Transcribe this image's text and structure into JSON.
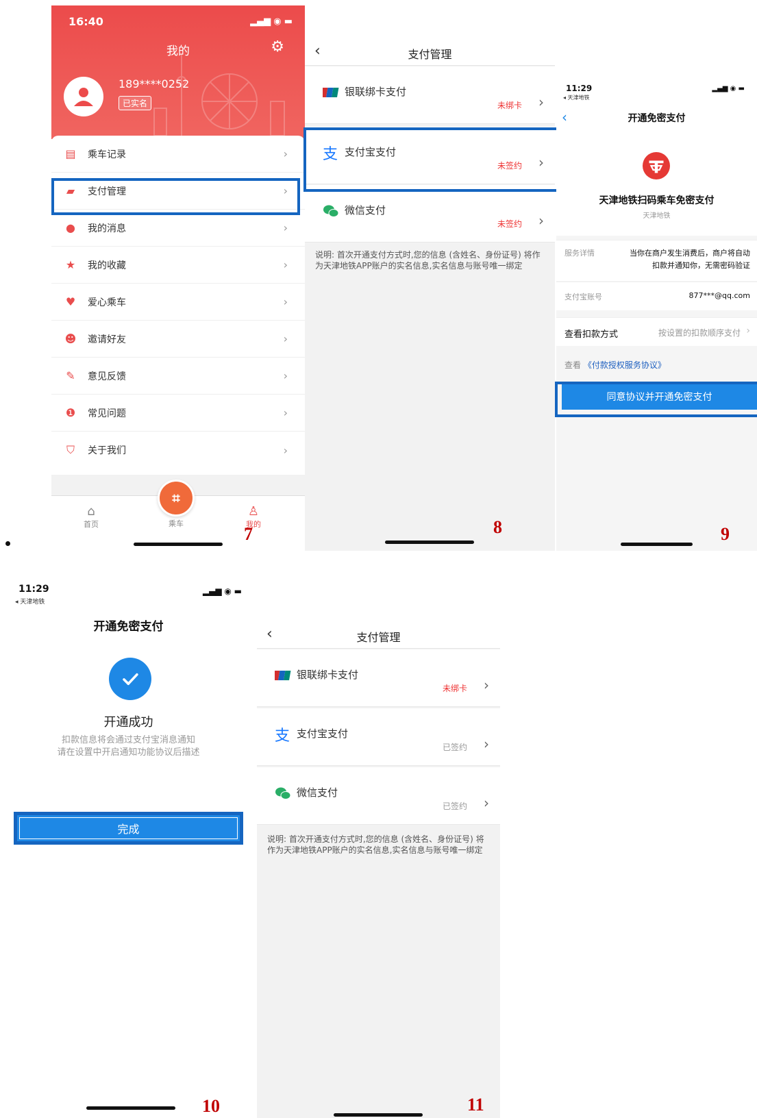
{
  "p7": {
    "time": "16:40",
    "title": "我的",
    "phone": "189****0252",
    "badge": "已实名",
    "menu": [
      {
        "label": "乘车记录",
        "icon": "ticket-icon"
      },
      {
        "label": "支付管理",
        "icon": "wallet-icon"
      },
      {
        "label": "我的消息",
        "icon": "message-icon"
      },
      {
        "label": "我的收藏",
        "icon": "star-icon"
      },
      {
        "label": "爱心乘车",
        "icon": "heart-icon"
      },
      {
        "label": "邀请好友",
        "icon": "friends-icon"
      },
      {
        "label": "意见反馈",
        "icon": "feedback-icon"
      },
      {
        "label": "常见问题",
        "icon": "info-icon"
      },
      {
        "label": "关于我们",
        "icon": "metro-logo-icon"
      }
    ],
    "tabs": {
      "home": "首页",
      "ride": "乘车",
      "mine": "我的"
    },
    "step": "7"
  },
  "p8": {
    "title": "支付管理",
    "rows": [
      {
        "label": "银联绑卡支付",
        "status": "未绑卡"
      },
      {
        "label": "支付宝支付",
        "status": "未签约"
      },
      {
        "label": "微信支付",
        "status": "未签约"
      }
    ],
    "note": "说明: 首次开通支付方式时,您的信息 (含姓名、身份证号) 将作为天津地铁APP账户的实名信息,实名信息与账号唯一绑定",
    "step": "8"
  },
  "p9": {
    "time": "11:29",
    "back_app": "◂ 天津地铁",
    "title": "开通免密支付",
    "service_name": "天津地铁扫码乘车免密支付",
    "service_sub": "天津地铁",
    "detail_key": "服务详情",
    "detail_value_1": "当你在商户发生消费后，商户将自动",
    "detail_value_2": "扣款并通知你，无需密码验证",
    "account_key": "支付宝账号",
    "account_value": "877***@qq.com",
    "method_key": "查看扣款方式",
    "method_value": "按设置的扣款顺序支付",
    "link_prefix": "查看",
    "link_text": "《付款授权服务协议》",
    "button": "同意协议并开通免密支付",
    "step": "9"
  },
  "p10": {
    "time": "11:29",
    "back_app": "◂ 天津地铁",
    "title": "开通免密支付",
    "success": "开通成功",
    "desc_1": "扣款信息将会通过支付宝消息通知",
    "desc_2": "请在设置中开启通知功能协议后描述",
    "button": "完成",
    "step": "10"
  },
  "p11": {
    "title": "支付管理",
    "rows": [
      {
        "label": "银联绑卡支付",
        "status": "未绑卡"
      },
      {
        "label": "支付宝支付",
        "status": "已签约"
      },
      {
        "label": "微信支付",
        "status": "已签约"
      }
    ],
    "note": "说明: 首次开通支付方式时,您的信息 (含姓名、身份证号) 将作为天津地铁APP账户的实名信息,实名信息与账号唯一绑定",
    "step": "11"
  },
  "colors": {
    "red": "#ec4b4b",
    "blue": "#1e88e5",
    "highlight": "#1565c0",
    "step": "#c00000"
  }
}
